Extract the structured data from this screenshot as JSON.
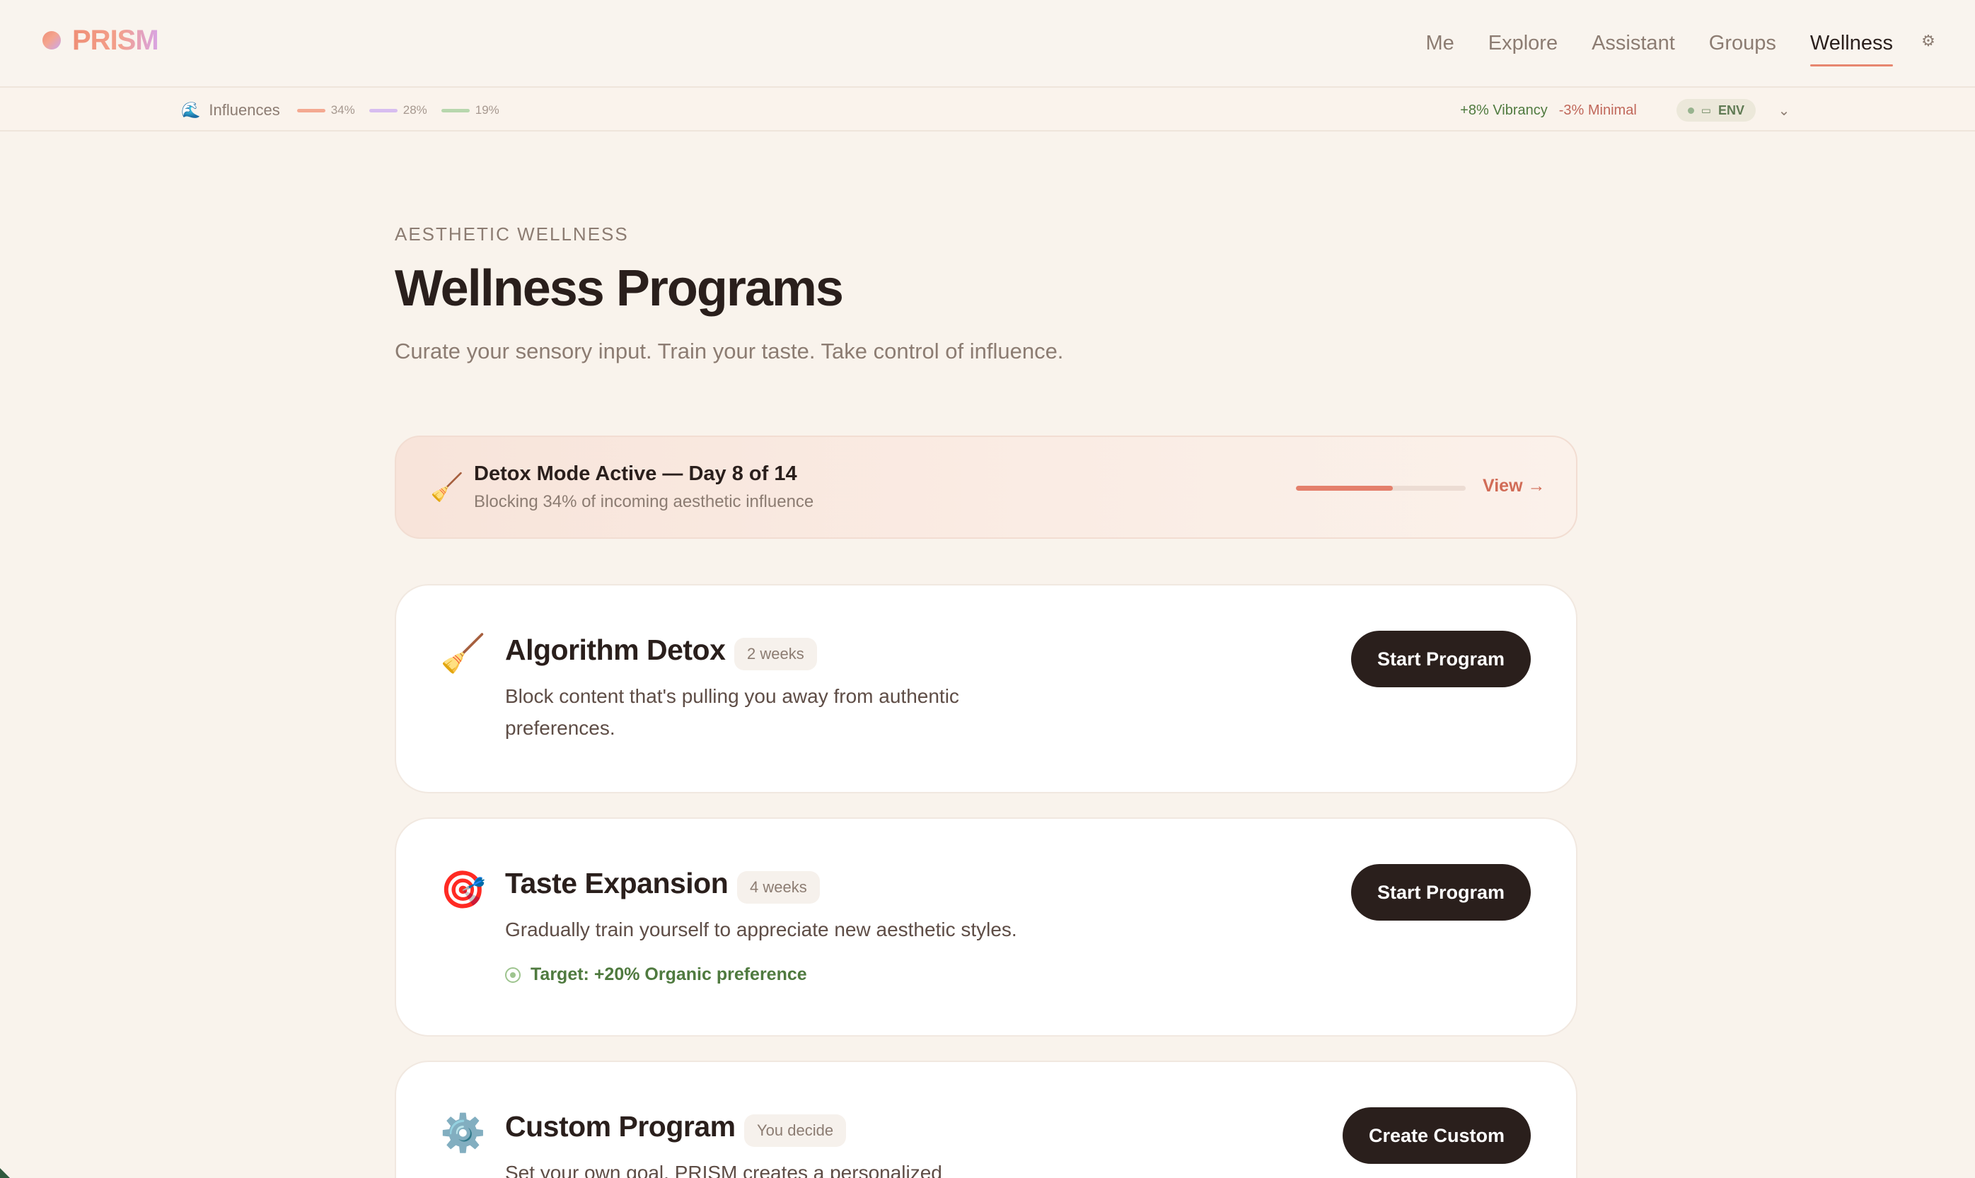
{
  "brand": {
    "name": "PRISM",
    "logo_icon": "prism-dot-logo"
  },
  "nav": {
    "items": [
      {
        "label": "Me",
        "active": false
      },
      {
        "label": "Explore",
        "active": false
      },
      {
        "label": "Assistant",
        "active": false
      },
      {
        "label": "Groups",
        "active": false
      },
      {
        "label": "Wellness",
        "active": true
      }
    ],
    "settings_icon": "gear-icon"
  },
  "influences": {
    "icon": "wave-emoji",
    "label": "Influences",
    "items": [
      {
        "value": "34%",
        "color": "#f4a991"
      },
      {
        "value": "28%",
        "color": "#d7bdf0"
      },
      {
        "value": "19%",
        "color": "#b7d7ad"
      }
    ],
    "delta_positive": "+8% Vibrancy",
    "delta_negative": "-3% Minimal",
    "env_label": "ENV",
    "chevron_icon": "chevron-down-icon"
  },
  "page": {
    "eyebrow": "AESTHETIC WELLNESS",
    "title": "Wellness Programs",
    "subtitle": "Curate your sensory input. Train your taste. Take control of influence."
  },
  "detox_banner": {
    "icon": "broom-emoji",
    "title": "Detox Mode Active — Day 8 of 14",
    "subtitle": "Blocking 34% of incoming aesthetic influence",
    "progress": 0.57,
    "view_label": "View →"
  },
  "programs": [
    {
      "icon": "broom-emoji",
      "title": "Algorithm Detox",
      "tag": "2 weeks",
      "description_line1": "Block content that's pulling you away from authentic",
      "description_line2": "preferences.",
      "button": "Start Program"
    },
    {
      "icon": "target-emoji",
      "title": "Taste Expansion",
      "tag": "4 weeks",
      "description_line1": "Gradually train yourself to appreciate new aesthetic styles.",
      "target": "Target: +20% Organic preference",
      "button": "Start Program"
    },
    {
      "icon": "gear-emoji",
      "title": "Custom Program",
      "tag": "You decide",
      "description_line1": "Set your own goal. PRISM creates a personalized",
      "button": "Create Custom"
    }
  ],
  "colors": {
    "accent": "#e7866f",
    "background": "#f9f3ec",
    "button_dark": "#2a1f1c",
    "positive": "#4f7a3f",
    "negative": "#c0675a"
  }
}
